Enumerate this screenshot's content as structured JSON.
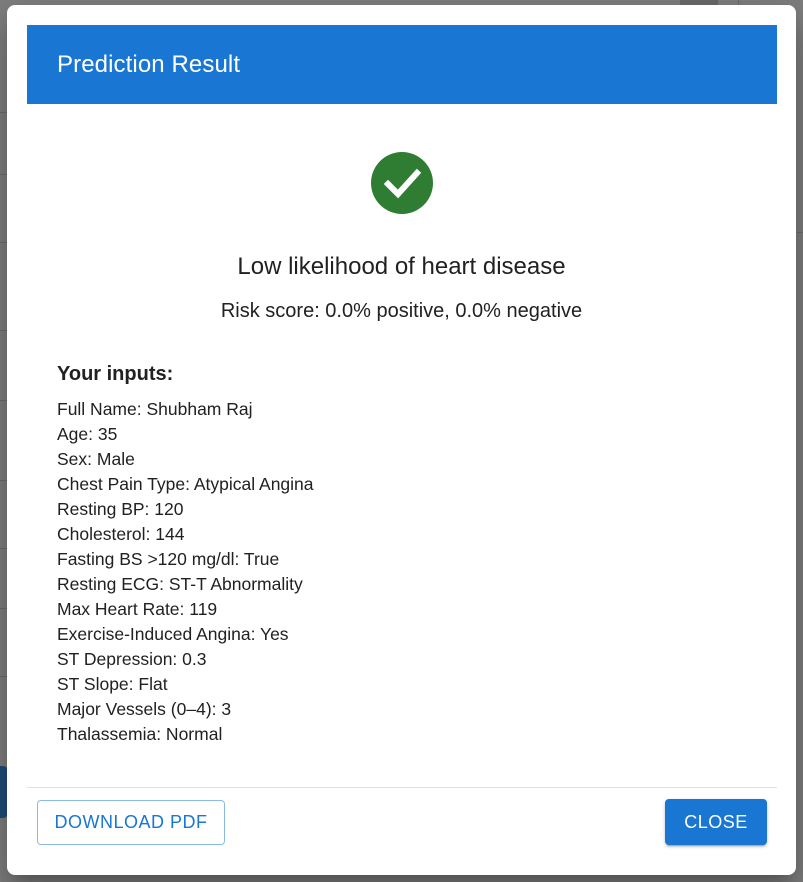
{
  "dialog": {
    "title": "Prediction Result",
    "status_icon": "check-circle-icon",
    "status_color": "#2e7d32",
    "header_color": "#1976d2",
    "result_heading": "Low likelihood of heart disease",
    "risk_score": "Risk score: 0.0% positive, 0.0% negative",
    "inputs_heading": "Your inputs:",
    "inputs": [
      "Full Name: Shubham Raj",
      "Age: 35",
      "Sex: Male",
      "Chest Pain Type: Atypical Angina",
      "Resting BP: 120",
      "Cholesterol: 144",
      "Fasting BS >120 mg/dl: True",
      "Resting ECG: ST-T Abnormality",
      "Max Heart Rate: 119",
      "Exercise-Induced Angina: Yes",
      "ST Depression: 0.3",
      "ST Slope: Flat",
      "Major Vessels (0–4): 3",
      "Thalassemia: Normal"
    ],
    "download_label": "DOWNLOAD PDF",
    "close_label": "CLOSE"
  }
}
